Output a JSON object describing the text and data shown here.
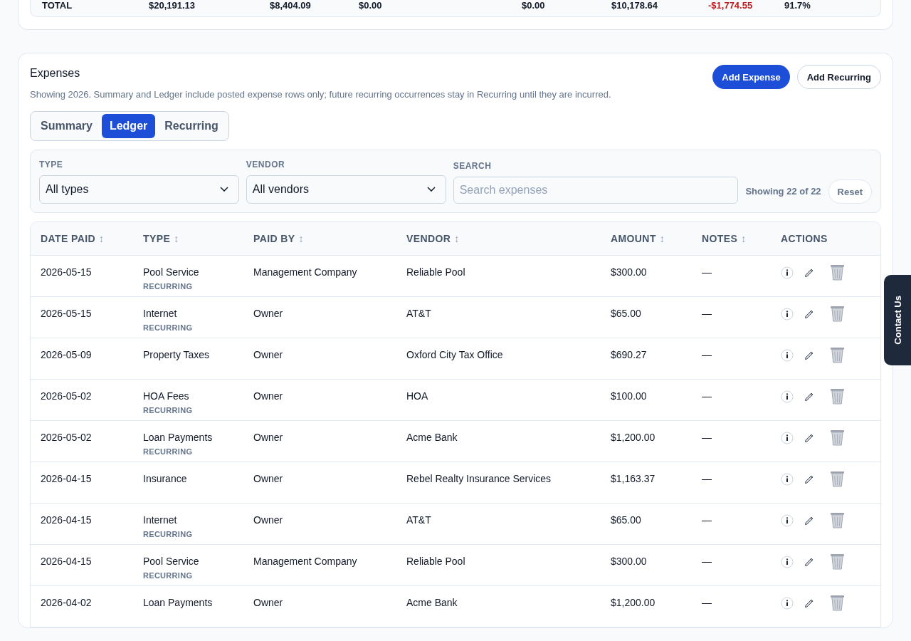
{
  "totals_row": [
    {
      "text": "TOTAL",
      "negative": false
    },
    {
      "text": "$20,191.13",
      "negative": false
    },
    {
      "text": "$8,404.09",
      "negative": false
    },
    {
      "text": "$0.00",
      "negative": false
    },
    {
      "text": "$0.00",
      "negative": false
    },
    {
      "text": "$10,178.64",
      "negative": false
    },
    {
      "text": "-$1,774.55",
      "negative": true
    },
    {
      "text": "91.7%",
      "negative": false
    }
  ],
  "expenses": {
    "title": "Expenses",
    "note": "Showing 2026. Summary and Ledger include posted expense rows only; future recurring occurrences stay in Recurring until they are incurred.",
    "buttons": [
      {
        "label": "Add Expense",
        "kind": "primary"
      },
      {
        "label": "Add Recurring",
        "kind": "secondary"
      }
    ],
    "tabs": [
      {
        "label": "Summary",
        "selected": false
      },
      {
        "label": "Ledger",
        "selected": true
      },
      {
        "label": "Recurring",
        "selected": false
      }
    ],
    "filters": {
      "type": {
        "label": "TYPE",
        "value": "All types"
      },
      "vendor": {
        "label": "VENDOR",
        "value": "All vendors"
      },
      "search": {
        "label": "SEARCH",
        "placeholder": "Search expenses"
      },
      "count": "Showing 22 of 22",
      "reset": "Reset"
    },
    "table": {
      "columns": [
        {
          "label": "DATE PAID",
          "sort": "↕"
        },
        {
          "label": "TYPE",
          "sort": "↕"
        },
        {
          "label": "PAID BY",
          "sort": "↕"
        },
        {
          "label": "VENDOR",
          "sort": "↕"
        },
        {
          "label": "AMOUNT",
          "sort": "↕"
        },
        {
          "label": "NOTES",
          "sort": "↕"
        },
        {
          "label": "ACTIONS"
        }
      ],
      "rows": [
        {
          "date": "2026-05-15",
          "type": "Pool Service",
          "tag": "RECURRING",
          "paid_by": "Management Company",
          "vendor": "Reliable Pool",
          "amount": "$300.00",
          "notes": "—"
        },
        {
          "date": "2026-05-15",
          "type": "Internet",
          "tag": "RECURRING",
          "paid_by": "Owner",
          "vendor": "AT&T",
          "amount": "$65.00",
          "notes": "—"
        },
        {
          "date": "2026-05-09",
          "type": "Property Taxes",
          "paid_by": "Owner",
          "vendor": "Oxford City Tax Office",
          "amount": "$690.27",
          "notes": "—"
        },
        {
          "date": "2026-05-02",
          "type": "HOA Fees",
          "tag": "RECURRING",
          "paid_by": "Owner",
          "vendor": "HOA",
          "amount": "$100.00",
          "notes": "—"
        },
        {
          "date": "2026-05-02",
          "type": "Loan Payments",
          "tag": "RECURRING",
          "paid_by": "Owner",
          "vendor": "Acme Bank",
          "amount": "$1,200.00",
          "notes": "—"
        },
        {
          "date": "2026-04-15",
          "type": "Insurance",
          "paid_by": "Owner",
          "vendor": "Rebel Realty Insurance Services",
          "amount": "$1,163.37",
          "notes": "—"
        },
        {
          "date": "2026-04-15",
          "type": "Internet",
          "tag": "RECURRING",
          "paid_by": "Owner",
          "vendor": "AT&T",
          "amount": "$65.00",
          "notes": "—"
        },
        {
          "date": "2026-04-15",
          "type": "Pool Service",
          "tag": "RECURRING",
          "paid_by": "Management Company",
          "vendor": "Reliable Pool",
          "amount": "$300.00",
          "notes": "—"
        },
        {
          "date": "2026-04-02",
          "type": "Loan Payments",
          "paid_by": "Owner",
          "vendor": "Acme Bank",
          "amount": "$1,200.00",
          "notes": "—"
        }
      ]
    }
  },
  "contact_tab": "Contact Us"
}
